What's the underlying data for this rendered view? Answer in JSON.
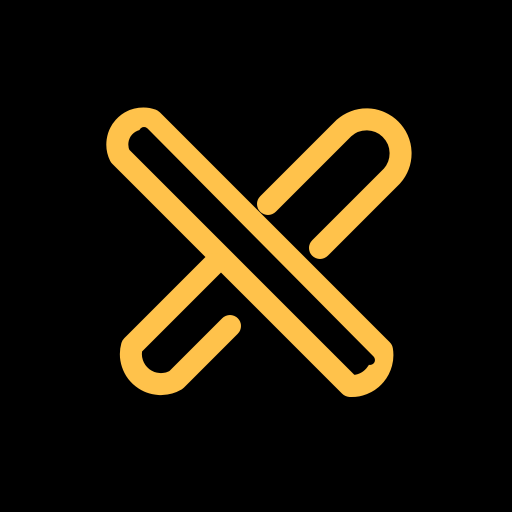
{
  "icon": {
    "name": "x-logo-icon",
    "description_visible_text": ""
  },
  "colors": {
    "background": "#000000",
    "stroke": "#FFC24B"
  }
}
